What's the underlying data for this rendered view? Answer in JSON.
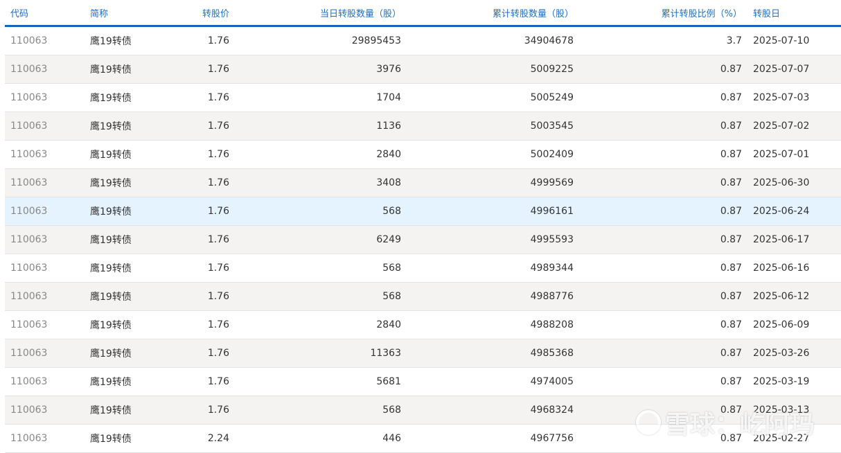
{
  "columns": [
    "代码",
    "简称",
    "转股价",
    "当日转股数量（股）",
    "累计转股数量（股）",
    "累计转股比例（%）",
    "转股日"
  ],
  "rows": [
    [
      "110063",
      "鹰19转债",
      "1.76",
      "29895453",
      "34904678",
      "3.7",
      "2025-07-10"
    ],
    [
      "110063",
      "鹰19转债",
      "1.76",
      "3976",
      "5009225",
      "0.87",
      "2025-07-07"
    ],
    [
      "110063",
      "鹰19转债",
      "1.76",
      "1704",
      "5005249",
      "0.87",
      "2025-07-03"
    ],
    [
      "110063",
      "鹰19转债",
      "1.76",
      "1136",
      "5003545",
      "0.87",
      "2025-07-02"
    ],
    [
      "110063",
      "鹰19转债",
      "1.76",
      "2840",
      "5002409",
      "0.87",
      "2025-07-01"
    ],
    [
      "110063",
      "鹰19转债",
      "1.76",
      "3408",
      "4999569",
      "0.87",
      "2025-06-30"
    ],
    [
      "110063",
      "鹰19转债",
      "1.76",
      "568",
      "4996161",
      "0.87",
      "2025-06-24"
    ],
    [
      "110063",
      "鹰19转债",
      "1.76",
      "6249",
      "4995593",
      "0.87",
      "2025-06-17"
    ],
    [
      "110063",
      "鹰19转债",
      "1.76",
      "568",
      "4989344",
      "0.87",
      "2025-06-16"
    ],
    [
      "110063",
      "鹰19转债",
      "1.76",
      "568",
      "4988776",
      "0.87",
      "2025-06-12"
    ],
    [
      "110063",
      "鹰19转债",
      "1.76",
      "2840",
      "4988208",
      "0.87",
      "2025-06-09"
    ],
    [
      "110063",
      "鹰19转债",
      "1.76",
      "11363",
      "4985368",
      "0.87",
      "2025-03-26"
    ],
    [
      "110063",
      "鹰19转债",
      "1.76",
      "5681",
      "4974005",
      "0.87",
      "2025-03-19"
    ],
    [
      "110063",
      "鹰19转债",
      "1.76",
      "568",
      "4968324",
      "0.87",
      "2025-03-13"
    ],
    [
      "110063",
      "鹰19转债",
      "2.24",
      "446",
      "4967756",
      "0.87",
      "2025-02-27"
    ]
  ],
  "watermark": "雪球：屹阿玛"
}
